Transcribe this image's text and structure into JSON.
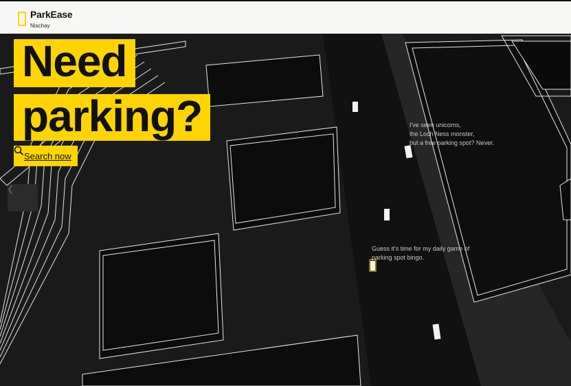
{
  "header": {
    "brand": "ParkEase",
    "subtitle": "Nischay",
    "logo_icon": "yellow-frame-icon"
  },
  "hero": {
    "line1": "Need",
    "line2": "parking?",
    "search_label": "Search now",
    "search_icon": "search-icon"
  },
  "carousel": {
    "prev_icon": "chevron-left-icon"
  },
  "quotes": {
    "q1": [
      "I've seen unicorns,",
      "the Loch Ness monster,",
      "but a free parking spot? Never."
    ],
    "q2": [
      "Guess it's time for my daily game of",
      "parking spot bingo."
    ]
  },
  "colors": {
    "accent": "#ffd400",
    "bg": "#1a1a1a",
    "header_bg": "#f7f7f5"
  }
}
